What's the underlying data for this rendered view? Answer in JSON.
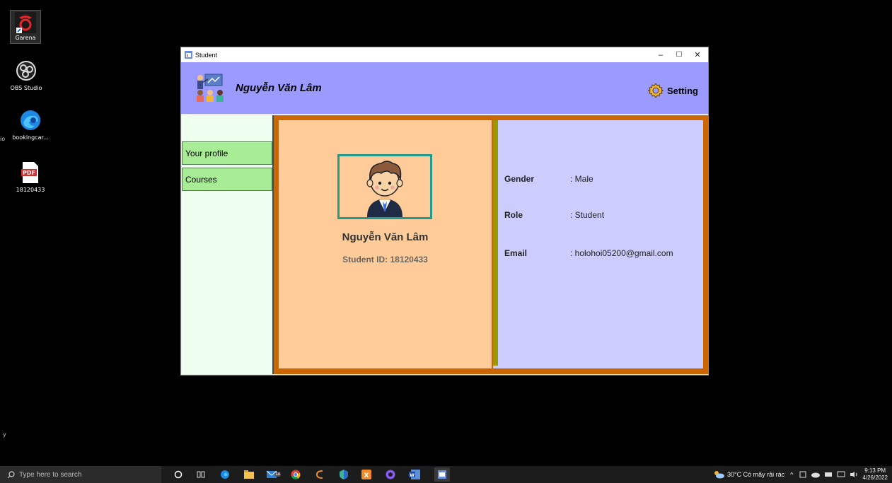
{
  "desktop": {
    "icons": [
      {
        "label": "Garena"
      },
      {
        "label": "OBS Studio"
      },
      {
        "label": "bookingcar..."
      },
      {
        "label": "18120433"
      }
    ],
    "edge_fragment_1": "io",
    "edge_fragment_2": "y"
  },
  "window": {
    "title": "Student",
    "controls": {
      "minimize": "–",
      "maximize": "☐",
      "close": "✕"
    }
  },
  "header": {
    "user_name": "Nguyễn Văn Lâm",
    "setting_label": "Setting"
  },
  "sidebar": {
    "items": [
      {
        "label": "Your profile"
      },
      {
        "label": "Courses"
      }
    ]
  },
  "profile": {
    "full_name": "Nguyễn Văn Lâm",
    "student_id": "Student ID: 18120433",
    "fields": [
      {
        "label": "Gender",
        "value": ": Male"
      },
      {
        "label": "Role",
        "value": ": Student"
      },
      {
        "label": "Email",
        "value": ": holohoi05200@gmail.com"
      }
    ]
  },
  "colors": {
    "header": "#9b9bff",
    "sidebar": "#efffef",
    "nav_button": "#a8ed96",
    "content_border": "#cc6600",
    "left_panel": "#ffcc99",
    "right_panel": "#ccccff",
    "accent_bar": "#999900",
    "avatar_border": "#1f9a8c"
  },
  "taskbar": {
    "search_placeholder": "Type here to search",
    "weather": "30°C  Có mây rải rác",
    "time": "9:13 PM",
    "date": "4/26/2022",
    "badge": "14"
  }
}
